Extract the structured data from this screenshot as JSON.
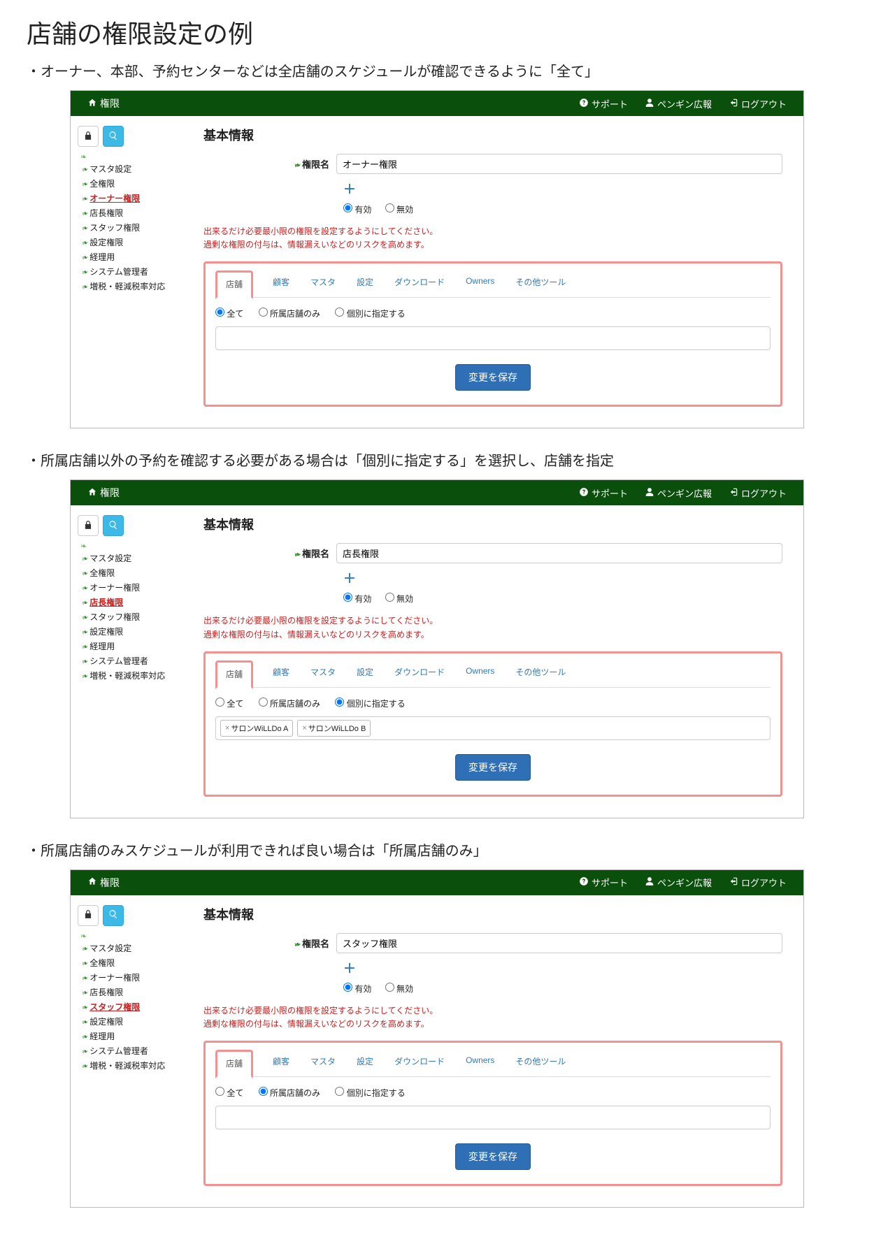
{
  "page_title": "店舗の権限設定の例",
  "topbar": {
    "brand_label": "権限",
    "support_label": "サポート",
    "user_label": "ペンギン広報",
    "logout_label": "ログアウト"
  },
  "sidebar_items": [
    "マスタ設定",
    "全権限",
    "オーナー権限",
    "店長権限",
    "スタッフ権限",
    "設定権限",
    "経理用",
    "システム管理者",
    "増税・軽減税率対応"
  ],
  "section_title": "基本情報",
  "form": {
    "name_label": "権限名",
    "plus_label": "＋",
    "status_enabled": "有効",
    "status_disabled": "無効"
  },
  "warning_line1": "出来るだけ必要最小限の権限を設定するようにしてください。",
  "warning_line2": "過剰な権限の付与は、情報漏えいなどのリスクを高めます。",
  "tabs": [
    "店舗",
    "顧客",
    "マスタ",
    "設定",
    "ダウンロード",
    "Owners",
    "その他ツール"
  ],
  "scope_options": {
    "all": "全て",
    "own": "所属店舗のみ",
    "individual": "個別に指定する"
  },
  "save_label": "変更を保存",
  "examples": [
    {
      "caption": "・オーナー、本部、予約センターなどは全店舗のスケジュールが確認できるように「全て」",
      "name_value": "オーナー権限",
      "active_sidebar_index": 2,
      "selected_scope": "all",
      "chips": []
    },
    {
      "caption": "・所属店舗以外の予約を確認する必要がある場合は「個別に指定する」を選択し、店舗を指定",
      "name_value": "店長権限",
      "active_sidebar_index": 3,
      "selected_scope": "individual",
      "chips": [
        "サロンWiLLDo A",
        "サロンWiLLDo B"
      ]
    },
    {
      "caption": "・所属店舗のみスケジュールが利用できれば良い場合は「所属店舗のみ」",
      "name_value": "スタッフ権限",
      "active_sidebar_index": 4,
      "selected_scope": "own",
      "chips": []
    }
  ]
}
